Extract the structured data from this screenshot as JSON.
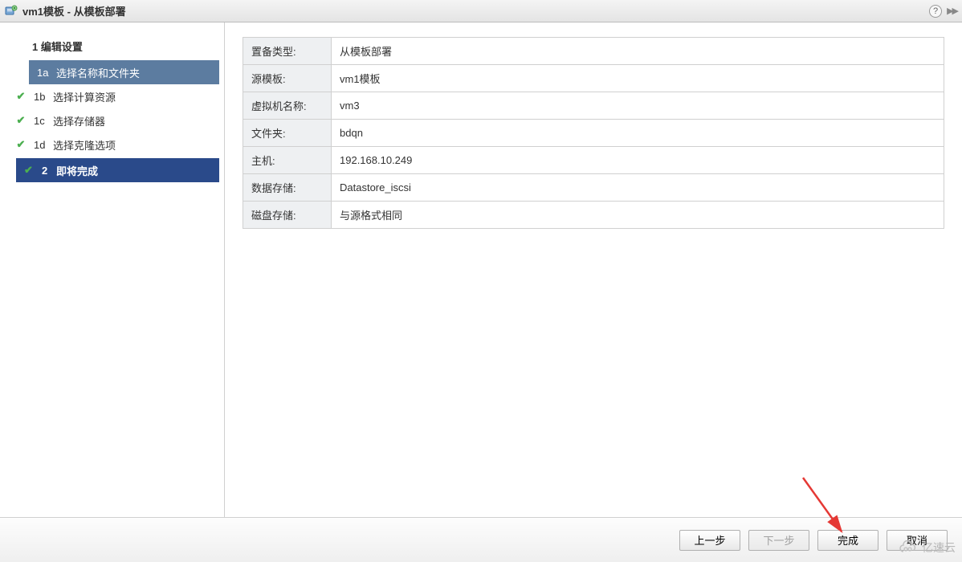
{
  "titlebar": {
    "title": "vm1模板 - 从模板部署"
  },
  "wizard": {
    "section1": {
      "num": "1",
      "label": "编辑设置"
    },
    "steps": [
      {
        "num": "1a",
        "label": "选择名称和文件夹",
        "done": true,
        "selected": true
      },
      {
        "num": "1b",
        "label": "选择计算资源",
        "done": true,
        "selected": false
      },
      {
        "num": "1c",
        "label": "选择存储器",
        "done": true,
        "selected": false
      },
      {
        "num": "1d",
        "label": "选择克隆选项",
        "done": true,
        "selected": false
      }
    ],
    "section2": {
      "num": "2",
      "label": "即将完成",
      "done": true
    }
  },
  "summary": [
    {
      "key": "置备类型:",
      "value": "从模板部署"
    },
    {
      "key": "源模板:",
      "value": "vm1模板"
    },
    {
      "key": "虚拟机名称:",
      "value": "vm3"
    },
    {
      "key": "文件夹:",
      "value": "bdqn"
    },
    {
      "key": "主机:",
      "value": "192.168.10.249"
    },
    {
      "key": "数据存储:",
      "value": "Datastore_iscsi"
    },
    {
      "key": "磁盘存储:",
      "value": "与源格式相同"
    }
  ],
  "footer": {
    "back": "上一步",
    "next": "下一步",
    "finish": "完成",
    "cancel": "取消"
  },
  "watermark": "亿速云"
}
